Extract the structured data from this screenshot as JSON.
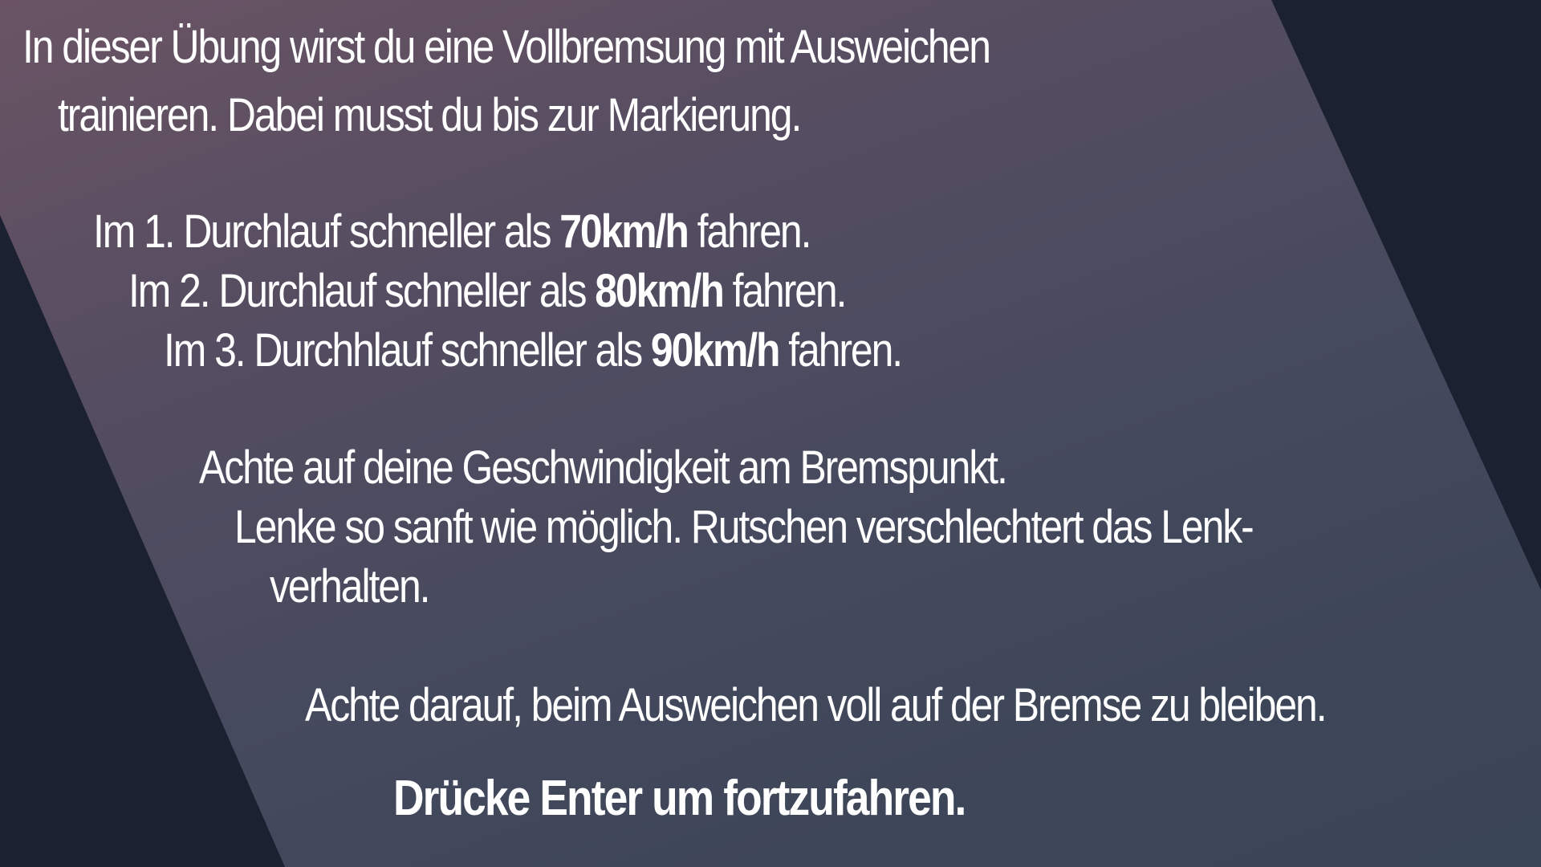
{
  "screen": {
    "colors": {
      "background": "#1b2130",
      "panel_top": "#6a5464",
      "panel_bottom": "#3a4557",
      "text": "#ffffff"
    }
  },
  "intro": {
    "line1": "In dieser Übung wirst du eine Vollbremsung mit Ausweichen",
    "line2": "trainieren. Dabei musst du bis zur Markierung."
  },
  "runs": [
    {
      "prefix": "Im 1. Durchlauf schneller als ",
      "speed": "70km/h",
      "suffix": " fahren."
    },
    {
      "prefix": "Im 2. Durchlauf schneller als ",
      "speed": "80km/h",
      "suffix": " fahren."
    },
    {
      "prefix": "Im 3. Durchhlauf schneller als ",
      "speed": "90km/h",
      "suffix": " fahren."
    }
  ],
  "tips": {
    "speed_tip": "Achte auf deine Geschwindigkeit am Bremspunkt.",
    "steer_tip_1": "Lenke so sanft wie möglich. Rutschen verschlechtert das Lenk-",
    "steer_tip_2": "verhalten.",
    "brake_tip": "Achte darauf, beim Ausweichen voll auf der Bremse zu bleiben."
  },
  "prompt": {
    "continue": "Drücke Enter um fortzufahren."
  }
}
